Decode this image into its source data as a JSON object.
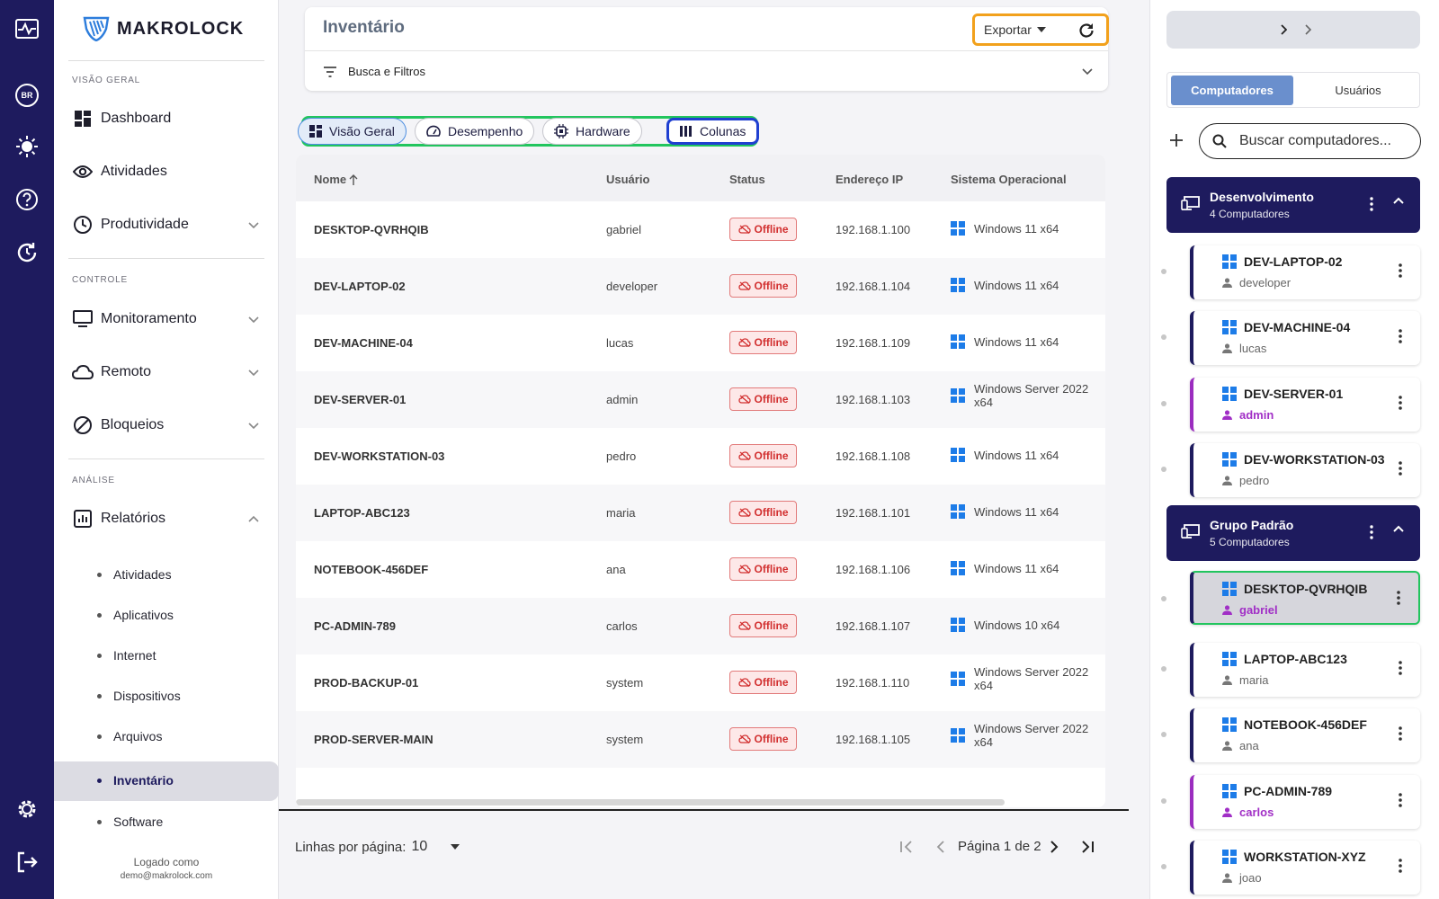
{
  "app": {
    "brand": "MAKROLOCK",
    "lang_badge": "BR"
  },
  "sidebar": {
    "sections": {
      "overview": "VISÃO GERAL",
      "control": "CONTROLE",
      "analysis": "ANÁLISE"
    },
    "items": {
      "dashboard": "Dashboard",
      "activities": "Atividades",
      "productivity": "Produtividade",
      "monitoring": "Monitoramento",
      "remote": "Remoto",
      "blocks": "Bloqueios",
      "reports": "Relatórios"
    },
    "report_sub": [
      "Atividades",
      "Aplicativos",
      "Internet",
      "Dispositivos",
      "Arquivos",
      "Inventário",
      "Software"
    ],
    "logged_label": "Logado como",
    "logged_user": "demo@makrolock.com"
  },
  "header": {
    "title": "Inventário",
    "export_label": "Exportar",
    "filters_label": "Busca e Filtros"
  },
  "tabs": [
    "Visão Geral",
    "Desempenho",
    "Hardware",
    "Colunas"
  ],
  "table": {
    "columns": [
      "Nome",
      "Usuário",
      "Status",
      "Endereço IP",
      "Sistema Operacional"
    ],
    "rows": [
      {
        "name": "DESKTOP-QVRHQIB",
        "user": "gabriel",
        "status": "Offline",
        "ip": "192.168.1.100",
        "os": "Windows 11 x64"
      },
      {
        "name": "DEV-LAPTOP-02",
        "user": "developer",
        "status": "Offline",
        "ip": "192.168.1.104",
        "os": "Windows 11 x64"
      },
      {
        "name": "DEV-MACHINE-04",
        "user": "lucas",
        "status": "Offline",
        "ip": "192.168.1.109",
        "os": "Windows 11 x64"
      },
      {
        "name": "DEV-SERVER-01",
        "user": "admin",
        "status": "Offline",
        "ip": "192.168.1.103",
        "os": "Windows Server 2022 x64"
      },
      {
        "name": "DEV-WORKSTATION-03",
        "user": "pedro",
        "status": "Offline",
        "ip": "192.168.1.108",
        "os": "Windows 11 x64"
      },
      {
        "name": "LAPTOP-ABC123",
        "user": "maria",
        "status": "Offline",
        "ip": "192.168.1.101",
        "os": "Windows 11 x64"
      },
      {
        "name": "NOTEBOOK-456DEF",
        "user": "ana",
        "status": "Offline",
        "ip": "192.168.1.106",
        "os": "Windows 11 x64"
      },
      {
        "name": "PC-ADMIN-789",
        "user": "carlos",
        "status": "Offline",
        "ip": "192.168.1.107",
        "os": "Windows 10 x64"
      },
      {
        "name": "PROD-BACKUP-01",
        "user": "system",
        "status": "Offline",
        "ip": "192.168.1.110",
        "os": "Windows Server 2022 x64"
      },
      {
        "name": "PROD-SERVER-MAIN",
        "user": "system",
        "status": "Offline",
        "ip": "192.168.1.105",
        "os": "Windows Server 2022 x64"
      }
    ]
  },
  "pagination": {
    "rows_label": "Linhas por página:",
    "rows_value": "10",
    "page_label": "Página 1 de 2"
  },
  "right_panel": {
    "tab_computers": "Computadores",
    "tab_users": "Usuários",
    "search_placeholder": "Buscar computadores...",
    "groups": [
      {
        "name": "Desenvolvimento",
        "count": "4 Computadores"
      },
      {
        "name": "Grupo Padrão",
        "count": "5 Computadores"
      }
    ],
    "devices": [
      {
        "name": "DEV-LAPTOP-02",
        "user": "developer"
      },
      {
        "name": "DEV-MACHINE-04",
        "user": "lucas"
      },
      {
        "name": "DEV-SERVER-01",
        "user": "admin"
      },
      {
        "name": "DEV-WORKSTATION-03",
        "user": "pedro"
      },
      {
        "name": "DESKTOP-QVRHQIB",
        "user": "gabriel"
      },
      {
        "name": "LAPTOP-ABC123",
        "user": "maria"
      },
      {
        "name": "NOTEBOOK-456DEF",
        "user": "ana"
      },
      {
        "name": "PC-ADMIN-789",
        "user": "carlos"
      },
      {
        "name": "WORKSTATION-XYZ",
        "user": "joao"
      }
    ]
  },
  "colors": {
    "rail": "#1e1b5e",
    "accent": "#6a8fcd",
    "offline": "#d23030",
    "highlight_green": "#22c55e",
    "highlight_orange": "#f2a11c",
    "highlight_blue": "#1f3fd1"
  }
}
